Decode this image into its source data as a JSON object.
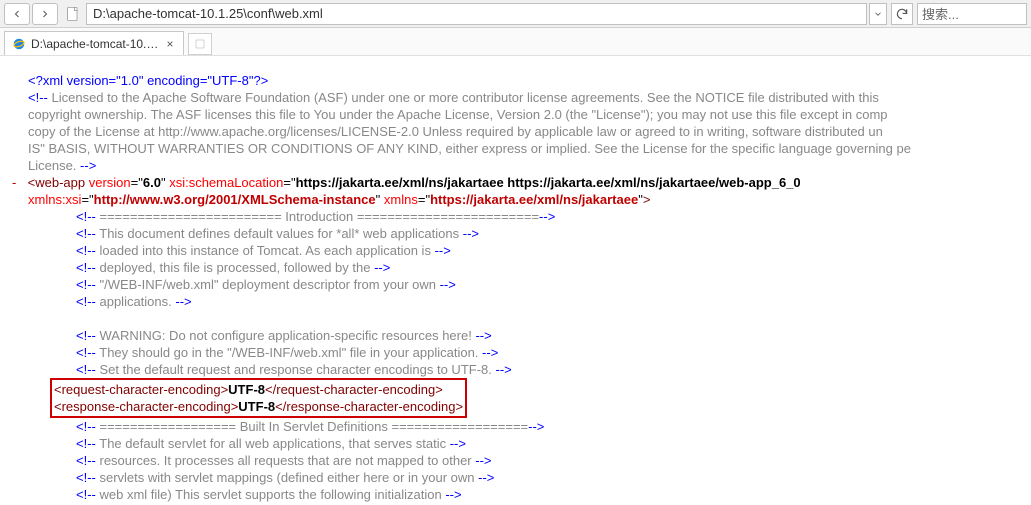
{
  "toolbar": {
    "address": "D:\\apache-tomcat-10.1.25\\conf\\web.xml",
    "search_placeholder": "搜索..."
  },
  "tab": {
    "title": "D:\\apache-tomcat-10.1.2...",
    "close": "×"
  },
  "xml": {
    "decl": "<?xml version=\"1.0\" encoding=\"UTF-8\"?>",
    "license_lines": [
      "Licensed to the Apache Software Foundation (ASF) under one or more contributor license agreements. See the NOTICE file distributed with this ",
      "copyright ownership. The ASF licenses this file to You under the Apache License, Version 2.0 (the \"License\"); you may not use this file except in comp",
      "copy of the License at http://www.apache.org/licenses/LICENSE-2.0 Unless required by applicable law or agreed to in writing, software distributed un",
      "IS\" BASIS, WITHOUT WARRANTIES OR CONDITIONS OF ANY KIND, either express or implied. See the License for the specific language governing pe",
      "License. "
    ],
    "webapp": {
      "tag_open": "web-app",
      "version_name": "version",
      "version_val": "6.0",
      "schemaLoc_name": "xsi:schemaLocation",
      "schemaLoc_val": "https://jakarta.ee/xml/ns/jakartaee https://jakarta.ee/xml/ns/jakartaee/web-app_6_0",
      "xmlnsxsi_name": "xmlns:xsi",
      "xmlnsxsi_val": "http://www.w3.org/2001/XMLSchema-instance",
      "xmlns_name": "xmlns",
      "xmlns_val": "https://jakarta.ee/xml/ns/jakartaee"
    },
    "body_comments": [
      "======================== Introduction ========================",
      "This document defines default values for *all* web applications ",
      "loaded into this instance of Tomcat. As each application is ",
      "deployed, this file is processed, followed by the ",
      "\"/WEB-INF/web.xml\" deployment descriptor from your own ",
      "applications. ",
      "WARNING: Do not configure application-specific resources here! ",
      "They should go in the \"/WEB-INF/web.xml\" file in your application. ",
      "Set the default request and response character encodings to UTF-8. "
    ],
    "req_enc_tag": "request-character-encoding",
    "res_enc_tag": "response-character-encoding",
    "enc_value": "UTF-8",
    "tail_comments": [
      "================== Built In Servlet Definitions ==================",
      "The default servlet for all web applications, that serves static ",
      "resources. It processes all requests that are not mapped to other ",
      "servlets with servlet mappings (defined either here or in your own ",
      "web xml file)  This servlet supports the following initialization "
    ]
  }
}
